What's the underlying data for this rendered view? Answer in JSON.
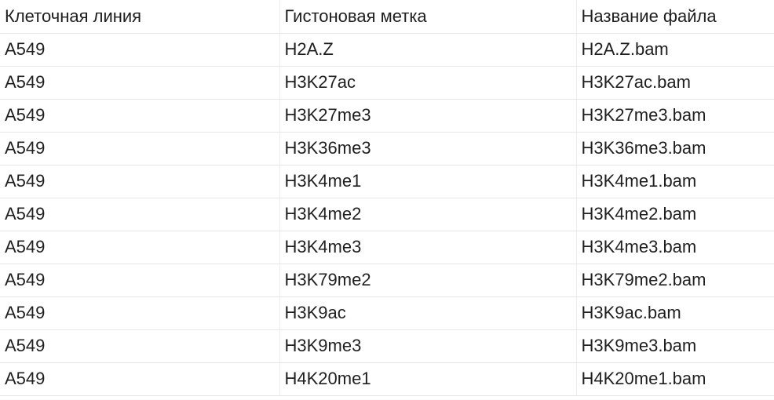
{
  "table": {
    "headers": [
      "Клеточная линия",
      "Гистоновая метка",
      "Название файла"
    ],
    "rows": [
      [
        "A549",
        "H2A.Z",
        "H2A.Z.bam"
      ],
      [
        "A549",
        "H3K27ac",
        "H3K27ac.bam"
      ],
      [
        "A549",
        "H3K27me3",
        "H3K27me3.bam"
      ],
      [
        "A549",
        "H3K36me3",
        "H3K36me3.bam"
      ],
      [
        "A549",
        "H3K4me1",
        "H3K4me1.bam"
      ],
      [
        "A549",
        "H3K4me2",
        "H3K4me2.bam"
      ],
      [
        "A549",
        "H3K4me3",
        "H3K4me3.bam"
      ],
      [
        "A549",
        "H3K79me2",
        "H3K79me2.bam"
      ],
      [
        "A549",
        "H3K9ac",
        "H3K9ac.bam"
      ],
      [
        "A549",
        "H3K9me3",
        "H3K9me3.bam"
      ],
      [
        "A549",
        "H4K20me1",
        "H4K20me1.bam"
      ]
    ]
  },
  "colors": {
    "text": "#1f1f1f",
    "background": "#ffffff",
    "row_border": "#e6e6e6"
  }
}
